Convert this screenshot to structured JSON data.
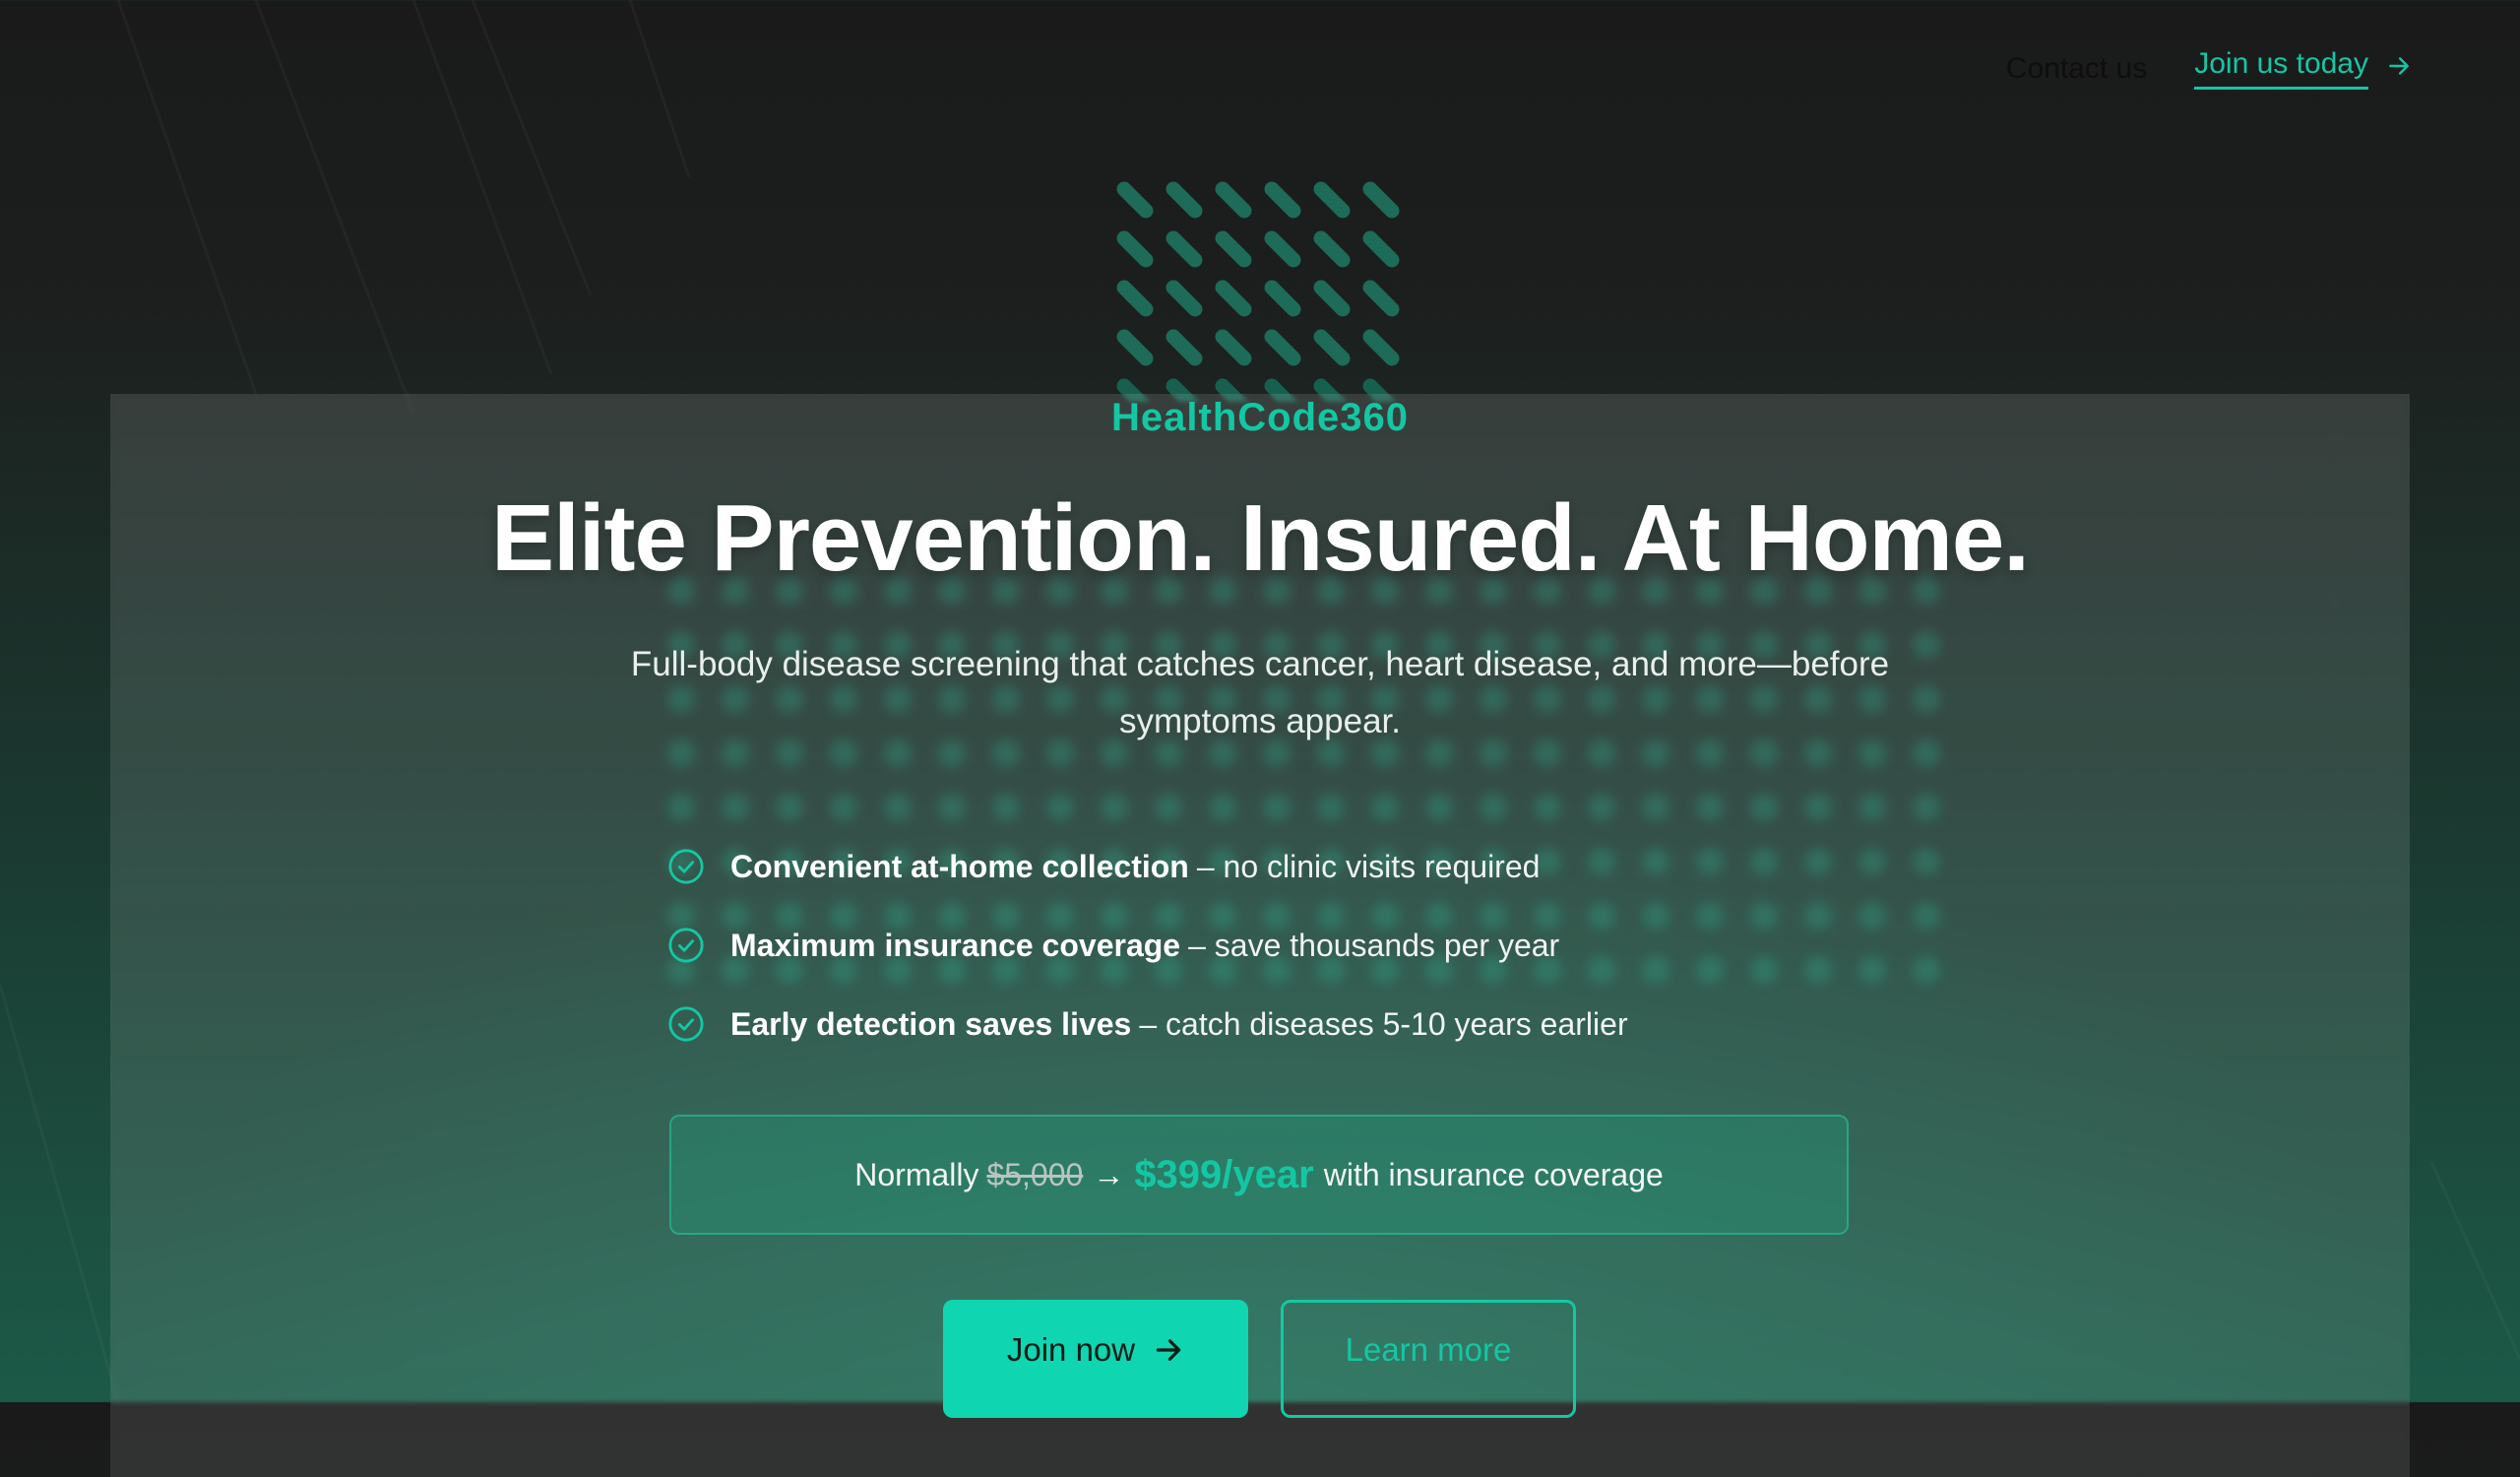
{
  "nav": {
    "contact_label": "Contact us",
    "join_label": "Join us today",
    "join_icon": "arrow-right-icon"
  },
  "hero": {
    "brand": "HealthCode360",
    "headline": "Elite Prevention. Insured. At Home.",
    "subheadline": "Full-body disease screening that catches cancer, heart disease, and more—before symptoms appear.",
    "features": [
      {
        "bold": "Convenient at-home collection",
        "rest": "– no clinic visits required",
        "icon": "check-circle-icon"
      },
      {
        "bold": "Maximum insurance coverage",
        "rest": "– save thousands per year",
        "icon": "check-circle-icon"
      },
      {
        "bold": "Early detection saves lives",
        "rest": "– catch diseases 5-10 years earlier",
        "icon": "check-circle-icon"
      }
    ],
    "pricing": {
      "prefix": "Normally",
      "old_price": "$5,000",
      "arrow": "→",
      "new_price": "$399/year",
      "suffix": "with insurance coverage"
    },
    "primary_button": "Join now",
    "secondary_button": "Learn more"
  },
  "colors": {
    "accent": "#14c7a4",
    "button": "#0fd6b0",
    "background_top": "#1a1a1a",
    "background_bottom": "#1c5a48"
  }
}
